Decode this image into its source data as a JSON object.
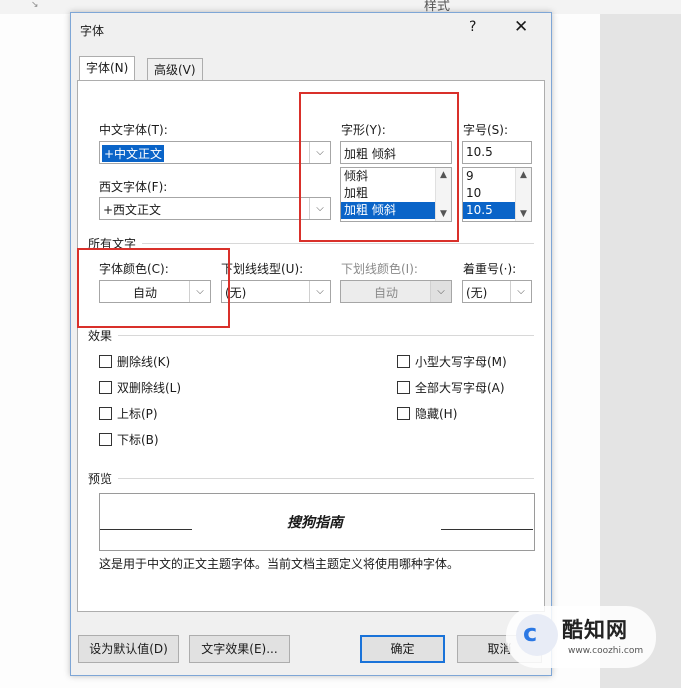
{
  "background": {
    "style_label": "样式",
    "corner_glyph": "↘"
  },
  "dialog": {
    "title": "字体",
    "help_label": "?",
    "close_label": "✕",
    "tabs": [
      {
        "label": "字体(N)",
        "active": true
      },
      {
        "label": "高级(V)",
        "active": false
      }
    ]
  },
  "font": {
    "chinese_font": {
      "label": "中文字体(T):",
      "value": "+中文正文"
    },
    "western_font": {
      "label": "西文字体(F):",
      "value": "+西文正文"
    },
    "style": {
      "label": "字形(Y):",
      "value": "加粗 倾斜",
      "options": [
        "倾斜",
        "加粗",
        "加粗 倾斜"
      ],
      "selected": "加粗 倾斜"
    },
    "size": {
      "label": "字号(S):",
      "value": "10.5",
      "options": [
        "9",
        "10",
        "10.5"
      ],
      "selected": "10.5"
    }
  },
  "all_text": {
    "title": "所有文字",
    "font_color": {
      "label": "字体颜色(C):",
      "value": "自动"
    },
    "underline_style": {
      "label": "下划线线型(U):",
      "value": "(无)"
    },
    "underline_color": {
      "label": "下划线颜色(I):",
      "value": "自动"
    },
    "emphasis_mark": {
      "label": "着重号(·):",
      "value": "(无)"
    }
  },
  "effects": {
    "title": "效果",
    "left": [
      "删除线(K)",
      "双删除线(L)",
      "上标(P)",
      "下标(B)"
    ],
    "right": [
      "小型大写字母(M)",
      "全部大写字母(A)",
      "隐藏(H)"
    ]
  },
  "preview": {
    "title": "预览",
    "sample_text": "搜狗指南",
    "note": "这是用于中文的正文主题字体。当前文档主题定义将使用哪种字体。"
  },
  "buttons": {
    "set_default": "设为默认值(D)",
    "text_effects": "文字效果(E)...",
    "ok": "确定",
    "cancel": "取消"
  },
  "watermark": {
    "brand": "酷知网",
    "url": "www.coozhi.com"
  },
  "colors": {
    "highlight": "#0a64c8",
    "annotation_red": "#d9302a",
    "dialog_bg": "#f0f0f0"
  }
}
